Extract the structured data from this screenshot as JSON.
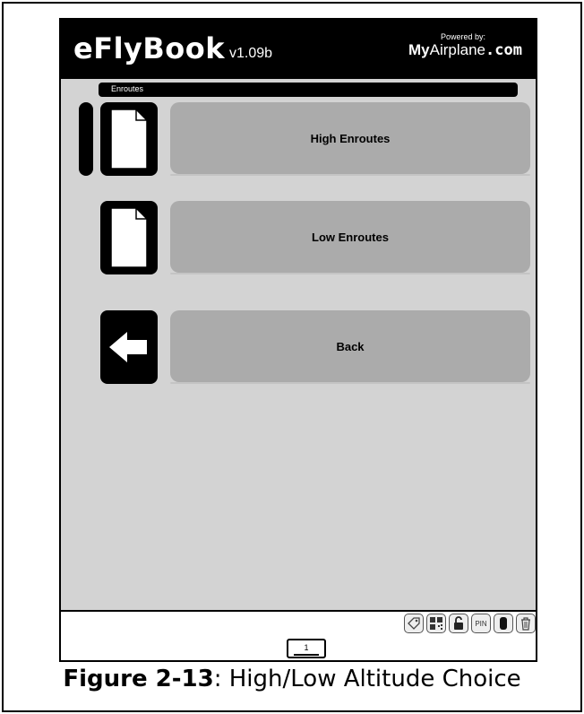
{
  "header": {
    "app_title": "eFlyBook",
    "version": "v1.09b",
    "powered_by": "Powered by:",
    "brand_strong": "My",
    "brand_light": "Airplane",
    "brand_suffix": ".com"
  },
  "section": {
    "title": "Enroutes"
  },
  "rows": [
    {
      "label": "High Enroutes",
      "icon": "document-icon"
    },
    {
      "label": "Low Enroutes",
      "icon": "document-icon"
    },
    {
      "label": "Back",
      "icon": "back-arrow-icon"
    }
  ],
  "footer": {
    "page_number": "1",
    "status_icons": [
      "tag-icon",
      "qr-icon",
      "lock-icon",
      "pin-icon",
      "battery-icon",
      "trash-icon"
    ],
    "pin_text": "PIN"
  },
  "caption": {
    "label": "Figure 2-13",
    "text": ": High/Low Altitude Choice"
  }
}
